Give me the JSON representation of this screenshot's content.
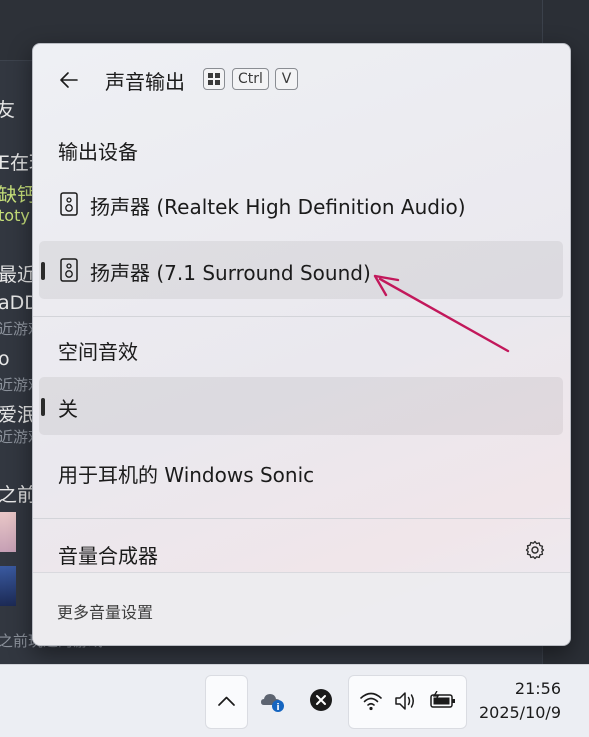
{
  "background_app": {
    "fragments": [
      "友",
      "E在玩",
      "缺钙",
      "toty",
      "最近玩",
      "aDD",
      "近游戏",
      "o",
      "近游戏",
      "爱泯",
      "近游戏",
      "之前",
      "之前玩过的游戏"
    ]
  },
  "flyout": {
    "title": "声音输出",
    "shortcut_keys": [
      "Ctrl",
      "V"
    ],
    "output_section_label": "输出设备",
    "devices": [
      {
        "label": "扬声器 (Realtek High Definition Audio)",
        "selected": false
      },
      {
        "label": "扬声器 (7.1 Surround Sound)",
        "selected": true
      }
    ],
    "spatial_section_label": "空间音效",
    "spatial_options": [
      {
        "label": "关",
        "selected": true
      },
      {
        "label": "用于耳机的 Windows Sonic",
        "selected": false
      }
    ],
    "mixer_label": "音量合成器",
    "more_settings": "更多音量设置"
  },
  "taskbar": {
    "time": "21:56",
    "date": "2025/10/9"
  },
  "colors": {
    "annotation_arrow": "#c2185b",
    "flyout_bg": "#eef0f4",
    "taskbar_bg": "#eceef3"
  }
}
